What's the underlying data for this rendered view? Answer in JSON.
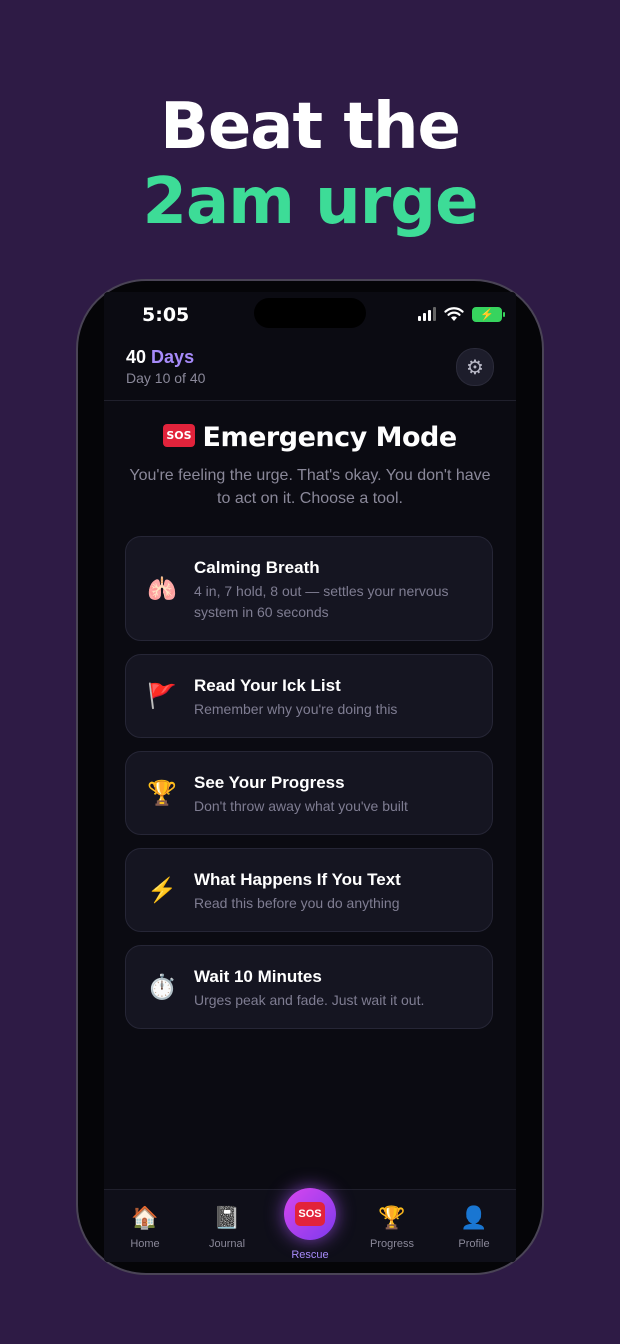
{
  "headline": {
    "line1": "Beat the",
    "line2": "2am urge"
  },
  "status_bar": {
    "time": "5:05"
  },
  "header": {
    "days_number": "40",
    "days_word": "Days",
    "subtitle": "Day 10 of 40"
  },
  "emergency": {
    "badge": "SOS",
    "title": "Emergency Mode",
    "subtitle": "You're feeling the urge. That's okay. You don't have to act on it. Choose a tool."
  },
  "tools": [
    {
      "icon": "🫁",
      "title": "Calming Breath",
      "desc": "4 in, 7 hold, 8 out — settles your nervous system in 60 seconds"
    },
    {
      "icon": "🚩",
      "title": "Read Your Ick List",
      "desc": "Remember why you're doing this"
    },
    {
      "icon": "🏆",
      "title": "See Your Progress",
      "desc": "Don't throw away what you've built"
    },
    {
      "icon": "⚡",
      "title": "What Happens If You Text",
      "desc": "Read this before you do anything"
    },
    {
      "icon": "⏱️",
      "title": "Wait 10 Minutes",
      "desc": "Urges peak and fade. Just wait it out."
    }
  ],
  "tabbar": {
    "home": {
      "icon": "🏠",
      "label": "Home"
    },
    "journal": {
      "icon": "📓",
      "label": "Journal"
    },
    "rescue": {
      "badge": "SOS",
      "label": "Rescue"
    },
    "progress": {
      "icon": "🏆",
      "label": "Progress"
    },
    "profile": {
      "icon": "👤",
      "label": "Profile"
    }
  },
  "colors": {
    "background": "#2e1b45",
    "accent_green": "#3ddc97",
    "accent_purple": "#a78bfa",
    "sos_red": "#e2233b"
  }
}
